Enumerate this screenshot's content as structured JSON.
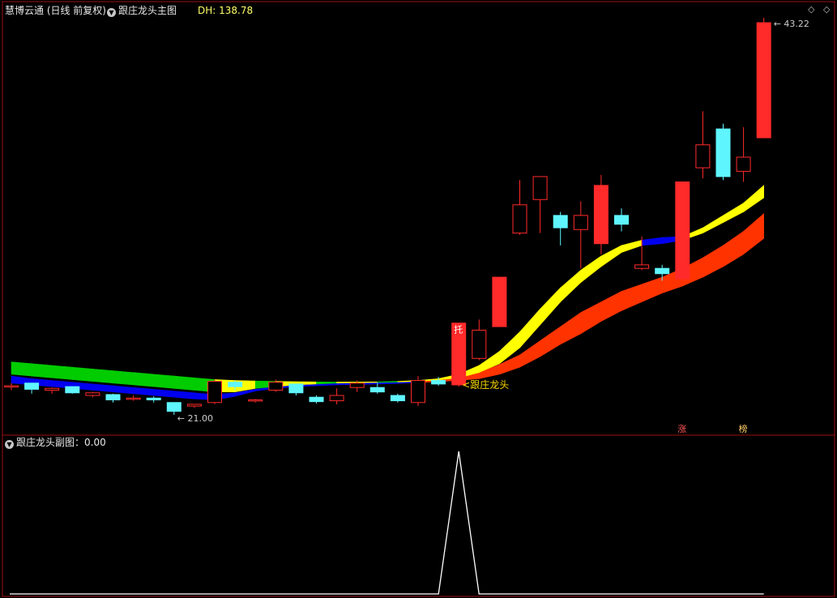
{
  "header": {
    "title": "慧博云通 (日线 前复权)",
    "main_indicator": "跟庄龙头主图",
    "dh_label": "DH: 138.78"
  },
  "sub_panel": {
    "indicator_label": "跟庄龙头副图：0.00"
  },
  "colors": {
    "up": "#ff2a2a",
    "down": "#5ff5ff",
    "frame": "#a01010",
    "band_green": "#00cc00",
    "band_blue": "#0000ee",
    "band_yellow": "#ffff00",
    "band_red": "#ff3300",
    "signal_line": "#ffffff"
  },
  "chart_data": {
    "type": "candlestick",
    "price_high_label": "43.22",
    "price_low_label": "21.00",
    "signal_text": "跟庄龙头",
    "marker_tuo": "托",
    "marker_zhang": "涨",
    "marker_bang": "榜",
    "candles": [
      {
        "o": 22.65,
        "h": 22.8,
        "l": 22.4,
        "c": 22.65
      },
      {
        "o": 22.8,
        "h": 22.8,
        "l": 22.2,
        "c": 22.45
      },
      {
        "o": 22.4,
        "h": 22.55,
        "l": 22.2,
        "c": 22.5
      },
      {
        "o": 22.6,
        "h": 22.6,
        "l": 22.2,
        "c": 22.25
      },
      {
        "o": 22.1,
        "h": 22.3,
        "l": 22.0,
        "c": 22.25
      },
      {
        "o": 22.15,
        "h": 22.2,
        "l": 21.7,
        "c": 21.85
      },
      {
        "o": 21.9,
        "h": 22.1,
        "l": 21.8,
        "c": 21.95
      },
      {
        "o": 21.95,
        "h": 22.05,
        "l": 21.7,
        "c": 21.85
      },
      {
        "o": 21.7,
        "h": 21.7,
        "l": 21.0,
        "c": 21.2
      },
      {
        "o": 21.5,
        "h": 21.6,
        "l": 21.4,
        "c": 21.6
      },
      {
        "o": 21.7,
        "h": 23.0,
        "l": 21.6,
        "c": 22.9
      },
      {
        "o": 22.85,
        "h": 22.95,
        "l": 22.4,
        "c": 22.6
      },
      {
        "o": 21.85,
        "h": 21.9,
        "l": 21.7,
        "c": 21.85
      },
      {
        "o": 22.4,
        "h": 23.0,
        "l": 22.3,
        "c": 22.85
      },
      {
        "o": 22.75,
        "h": 22.75,
        "l": 22.1,
        "c": 22.25
      },
      {
        "o": 22.0,
        "h": 22.1,
        "l": 21.65,
        "c": 21.75
      },
      {
        "o": 21.8,
        "h": 22.5,
        "l": 21.6,
        "c": 22.1
      },
      {
        "o": 22.55,
        "h": 22.95,
        "l": 22.3,
        "c": 22.8
      },
      {
        "o": 22.55,
        "h": 22.8,
        "l": 22.2,
        "c": 22.3
      },
      {
        "o": 22.1,
        "h": 22.2,
        "l": 21.7,
        "c": 21.8
      },
      {
        "o": 21.7,
        "h": 23.2,
        "l": 21.5,
        "c": 22.95
      },
      {
        "o": 22.95,
        "h": 23.15,
        "l": 22.65,
        "c": 22.75
      },
      {
        "o": 22.7,
        "h": 26.2,
        "l": 22.6,
        "c": 26.2
      },
      {
        "o": 24.2,
        "h": 26.4,
        "l": 24.1,
        "c": 25.8
      },
      {
        "o": 26.0,
        "h": 28.8,
        "l": 26.0,
        "c": 28.8
      },
      {
        "o": 31.3,
        "h": 34.3,
        "l": 31.2,
        "c": 32.9
      },
      {
        "o": 33.2,
        "h": 33.8,
        "l": 31.3,
        "c": 34.5
      },
      {
        "o": 32.3,
        "h": 32.5,
        "l": 30.6,
        "c": 31.6
      },
      {
        "o": 31.5,
        "h": 33.1,
        "l": 29.3,
        "c": 32.3
      },
      {
        "o": 30.7,
        "h": 34.6,
        "l": 30.1,
        "c": 34.0
      },
      {
        "o": 32.3,
        "h": 32.7,
        "l": 31.4,
        "c": 31.8
      },
      {
        "o": 29.3,
        "h": 31.1,
        "l": 29.2,
        "c": 29.5
      },
      {
        "o": 29.3,
        "h": 29.5,
        "l": 28.6,
        "c": 29.0
      },
      {
        "o": 28.7,
        "h": 34.2,
        "l": 28.6,
        "c": 34.2
      },
      {
        "o": 35.0,
        "h": 38.2,
        "l": 34.4,
        "c": 36.3
      },
      {
        "o": 37.2,
        "h": 37.5,
        "l": 34.3,
        "c": 34.5
      },
      {
        "o": 34.8,
        "h": 37.3,
        "l": 34.2,
        "c": 35.6
      },
      {
        "o": 36.7,
        "h": 43.5,
        "l": 36.7,
        "c": 43.22
      }
    ],
    "upper_band_top": [
      24.0,
      23.9,
      23.8,
      23.7,
      23.6,
      23.5,
      23.4,
      23.3,
      23.2,
      23.1,
      23.0,
      22.95,
      22.92,
      22.9,
      22.88,
      22.87,
      22.86,
      22.86,
      22.87,
      22.9,
      22.95,
      23.05,
      23.3,
      23.8,
      24.6,
      25.7,
      27.0,
      28.2,
      29.2,
      30.0,
      30.6,
      30.9,
      31.05,
      31.1,
      31.6,
      32.3,
      33.0,
      34.0
    ],
    "upper_band_bottom": [
      23.3,
      23.2,
      23.1,
      23.0,
      22.9,
      22.8,
      22.7,
      22.6,
      22.5,
      22.4,
      22.3,
      22.3,
      22.5,
      22.6,
      22.7,
      22.75,
      22.8,
      22.82,
      22.84,
      22.86,
      22.9,
      22.98,
      23.1,
      23.4,
      23.9,
      24.8,
      26.1,
      27.4,
      28.5,
      29.4,
      30.2,
      30.6,
      30.7,
      30.9,
      31.3,
      31.9,
      32.5,
      33.3
    ],
    "lower_band_top": [
      23.2,
      23.05,
      22.95,
      22.85,
      22.75,
      22.65,
      22.55,
      22.45,
      22.35,
      22.25,
      22.15,
      22.25,
      22.45,
      22.6,
      22.7,
      22.75,
      22.78,
      22.8,
      22.82,
      22.85,
      22.9,
      22.97,
      23.1,
      23.4,
      23.85,
      24.4,
      25.2,
      26.0,
      26.8,
      27.4,
      28.0,
      28.4,
      28.8,
      29.3,
      29.9,
      30.6,
      31.4,
      32.4
    ],
    "lower_band_bottom": [
      22.8,
      22.7,
      22.6,
      22.5,
      22.4,
      22.3,
      22.2,
      22.1,
      22.0,
      21.9,
      21.85,
      22.05,
      22.35,
      22.5,
      22.6,
      22.65,
      22.7,
      22.72,
      22.75,
      22.78,
      22.83,
      22.88,
      22.95,
      23.05,
      23.3,
      23.7,
      24.3,
      25.0,
      25.6,
      26.3,
      26.9,
      27.4,
      27.9,
      28.3,
      28.8,
      29.4,
      30.1,
      31.0
    ],
    "sub_signal_index": 22
  }
}
